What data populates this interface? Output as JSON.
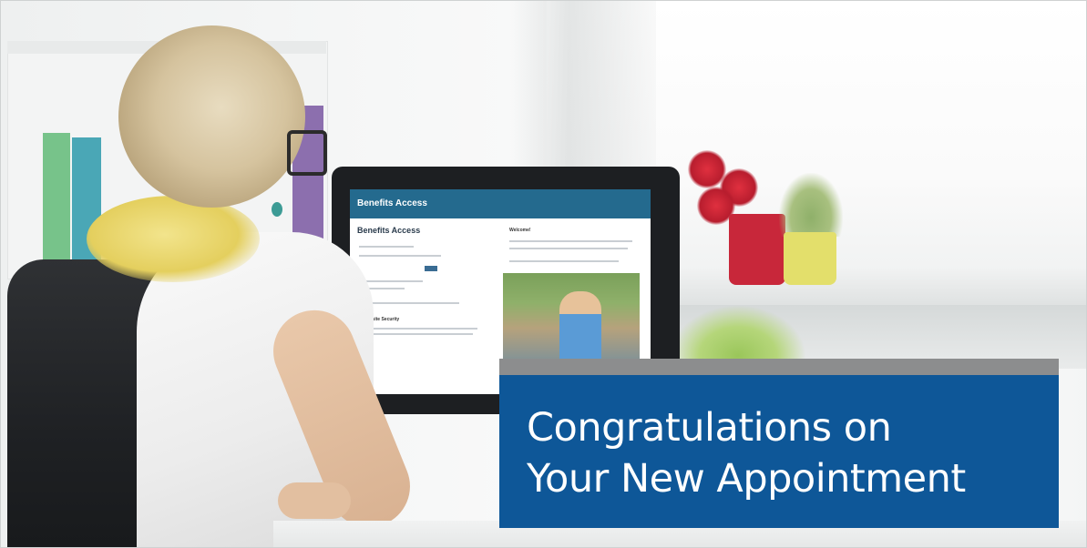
{
  "banner": {
    "line1": "Congratulations on",
    "line2": "Your New Appointment",
    "colors": {
      "bar": "#8c8d8e",
      "body": "#0e5798",
      "text": "#ffffff"
    }
  },
  "monitor_screen": {
    "header": "Benefits Access",
    "title": "Benefits Access",
    "welcome": "Welcome!",
    "security": "Website Security"
  }
}
